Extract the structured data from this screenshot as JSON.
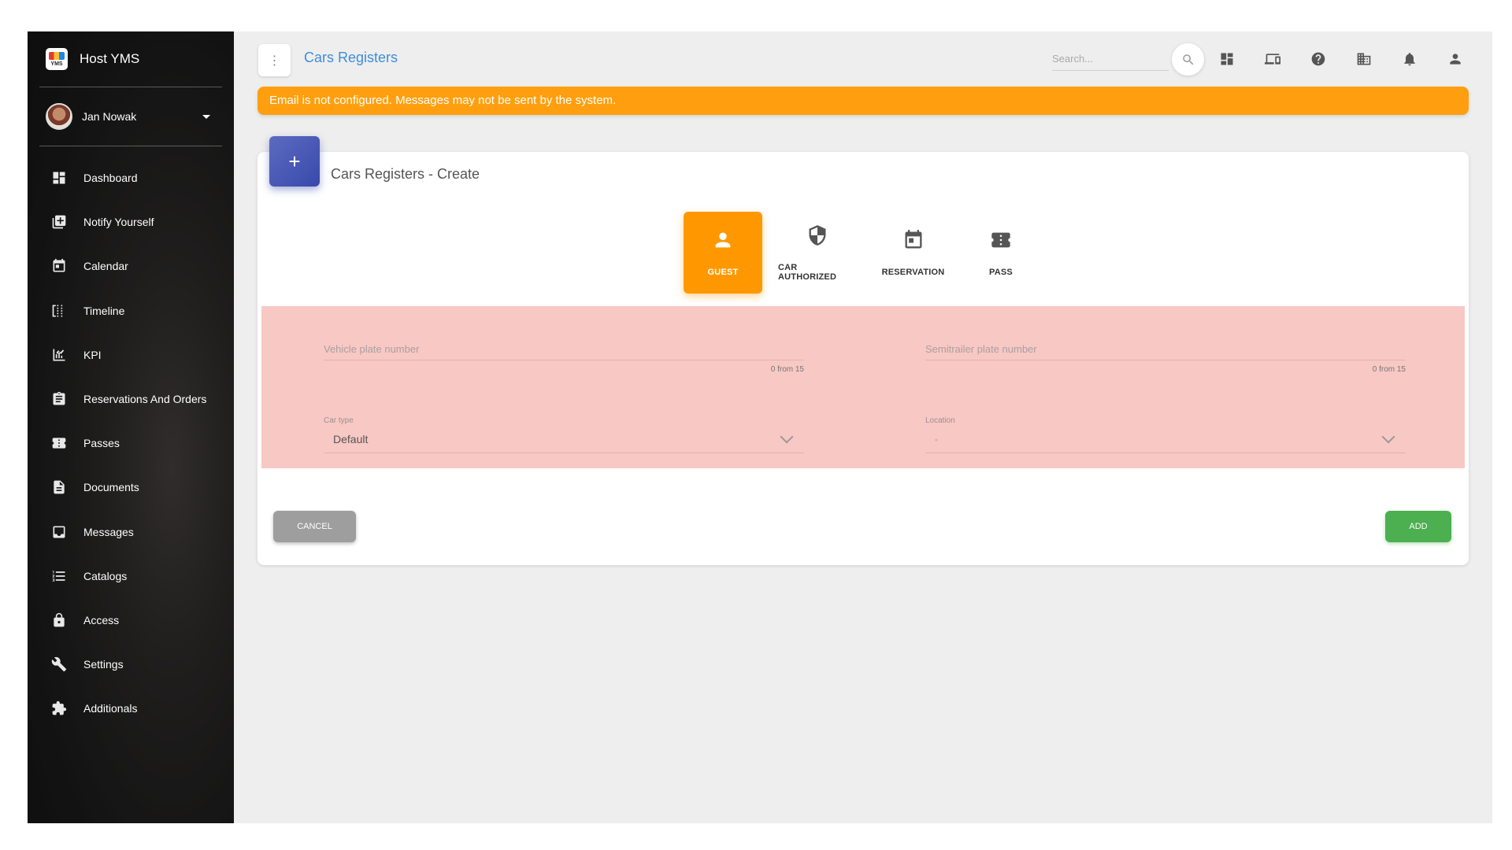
{
  "sidebar": {
    "brand": "Host YMS",
    "logo_text": "YMS",
    "user": "Jan Nowak",
    "items": [
      {
        "label": "Dashboard",
        "icon": "dashboard-icon"
      },
      {
        "label": "Notify Yourself",
        "icon": "add-box-icon"
      },
      {
        "label": "Calendar",
        "icon": "calendar-icon"
      },
      {
        "label": "Timeline",
        "icon": "timeline-icon"
      },
      {
        "label": "KPI",
        "icon": "chart-icon"
      },
      {
        "label": "Reservations And Orders",
        "icon": "clipboard-icon"
      },
      {
        "label": "Passes",
        "icon": "ticket-icon"
      },
      {
        "label": "Documents",
        "icon": "document-icon"
      },
      {
        "label": "Messages",
        "icon": "inbox-icon"
      },
      {
        "label": "Catalogs",
        "icon": "list-icon"
      },
      {
        "label": "Access",
        "icon": "lock-icon"
      },
      {
        "label": "Settings",
        "icon": "wrench-icon"
      },
      {
        "label": "Additionals",
        "icon": "puzzle-icon"
      }
    ]
  },
  "header": {
    "menu_glyph": "⋮",
    "title": "Cars Registers",
    "search_placeholder": "Search..."
  },
  "banner": {
    "text": "Email is not configured. Messages may not be sent by the system.",
    "color": "#ff9f0f"
  },
  "card": {
    "badge": "+",
    "title": "Cars Registers - Create"
  },
  "tabs": [
    {
      "label": "GUEST",
      "icon": "person-icon",
      "active": true
    },
    {
      "label": "CAR AUTHORIZED",
      "icon": "shield-icon",
      "active": false
    },
    {
      "label": "RESERVATION",
      "icon": "calendar-icon",
      "active": false
    },
    {
      "label": "PASS",
      "icon": "ticket-icon",
      "active": false
    }
  ],
  "form": {
    "vehicle_plate": {
      "placeholder": "Vehicle plate number",
      "counter": "0 from 15"
    },
    "semitrailer_plate": {
      "placeholder": "Semitrailer plate number",
      "counter": "0 from 15"
    },
    "car_type": {
      "label": "Car type",
      "value": "Default"
    },
    "location": {
      "label": "Location",
      "value": "-"
    }
  },
  "buttons": {
    "cancel": "CANCEL",
    "add": "ADD"
  },
  "colors": {
    "accent": "#ff9800",
    "title_blue": "#3d8ede",
    "add_green": "#4caf50",
    "form_bg": "#f8c8c4"
  }
}
